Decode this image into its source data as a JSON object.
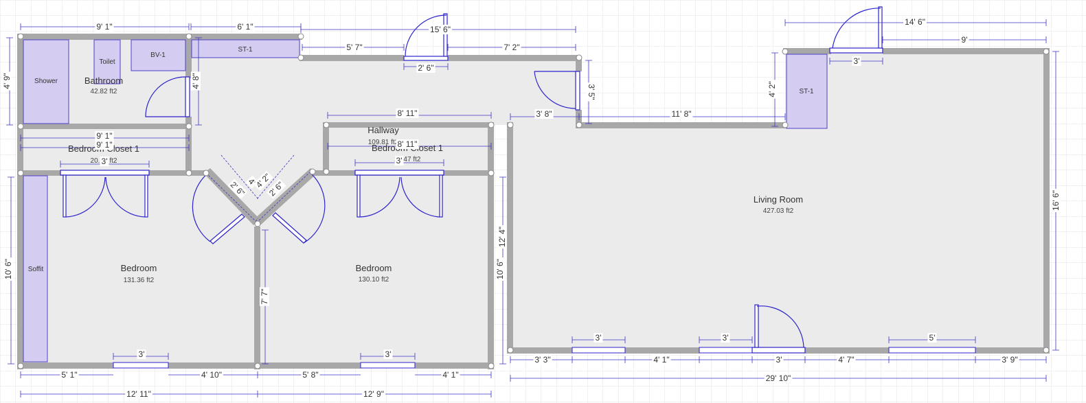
{
  "colors": {
    "background": "#ffffff",
    "grid": "#e3e3e3",
    "floor": "#ebebeb",
    "wall": "#a8a8a8",
    "fixture_fill": "#d4cdf1",
    "fixture_stroke": "#4b40c8",
    "door_stroke": "#2c22cc",
    "dimension_line": "#3a33c4",
    "label_text": "#333333"
  },
  "rooms": {
    "bathroom": {
      "name": "Bathroom",
      "area": "42.82 ft2"
    },
    "hallway": {
      "name": "Hallway",
      "area": "109.81 ft2"
    },
    "closet_left": {
      "name": "Bedroom Closet 1",
      "area": "20.93 ft2"
    },
    "closet_right": {
      "name": "Bedroom Closet 1",
      "area": "20.47 ft2"
    },
    "bedroom_left": {
      "name": "Bedroom",
      "area": "131.36 ft2"
    },
    "bedroom_right": {
      "name": "Bedroom",
      "area": "130.10 ft2"
    },
    "living_room": {
      "name": "Living Room",
      "area": "427.03 ft2"
    }
  },
  "fixtures": {
    "shower": "Shower",
    "toilet": "Toilet",
    "vanity": "BV-1",
    "storage_hall": "ST-1",
    "storage_living": "ST-1",
    "soffit": "Soffit"
  },
  "dimensions": {
    "bath_top": "9' 1\"",
    "st_top": "6' 1\"",
    "hall_top_total": "15' 6\"",
    "hall_top_left": "5' 7\"",
    "hall_top_right": "7' 2\"",
    "hall_door": "2' 6\"",
    "bath_left": "4' 9\"",
    "bath_right": "4' 8\"",
    "bath_bottom": "9' 1\"",
    "closet_left_top": "9' 1\"",
    "closet_left_door": "3'",
    "hall_mid": "8' 11\"",
    "closet_right_top": "8' 11\"",
    "closet_right_door": "3'",
    "hall_nook": "3' 8\"",
    "hall_end": "3' 5\"",
    "living_top_total": "14' 6\"",
    "living_top_right": "9'",
    "living_door_top": "3'",
    "living_st_height": "4' 2\"",
    "living_left_top": "11' 8\"",
    "living_right": "16' 6\"",
    "diag_1": "4'",
    "diag_2": "4' 2\"",
    "diag_3": "2' 6\"",
    "diag_4": "2' 6\"",
    "bed_left_side": "10' 6\"",
    "bed_mid_wall": "7' 7\"",
    "bed_right_wall": "12' 4\"",
    "living_left_wall": "10' 6\"",
    "bed_left_window": "3'",
    "bed_right_window": "3'",
    "bed_left_bottom_a": "5' 1\"",
    "bed_left_bottom_b": "4' 10\"",
    "bed_right_bottom_a": "5' 8\"",
    "bed_right_bottom_b": "4' 1\"",
    "bed_left_total": "12' 11\"",
    "bed_right_total": "12' 9\"",
    "living_win1": "3'",
    "living_win2": "3'",
    "living_door_bottom": "3'",
    "living_win3": "5'",
    "living_seg1": "3' 3\"",
    "living_seg2": "4' 1\"",
    "living_seg3": "4' 7\"",
    "living_seg4": "3' 9\"",
    "living_total": "29' 10\""
  }
}
